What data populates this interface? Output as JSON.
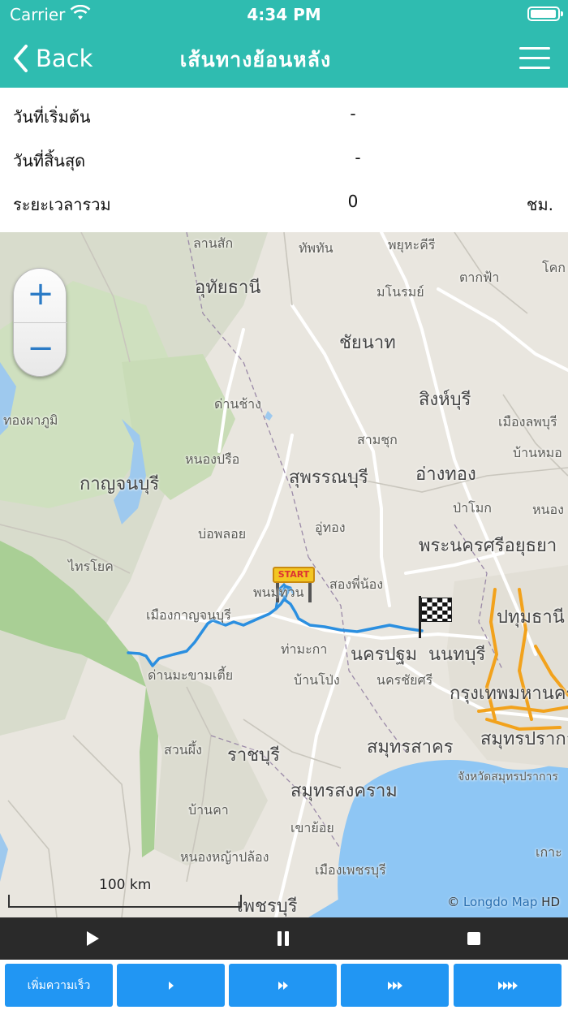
{
  "status_bar": {
    "carrier": "Carrier",
    "time": "4:34 PM"
  },
  "nav": {
    "back_label": "Back",
    "title": "เส้นทางย้อนหลัง"
  },
  "info": {
    "start_date_label": "วันที่เริ่มต้น",
    "start_date_value": "-",
    "end_date_label": "วันที่สิ้นสุด",
    "end_date_value": "-",
    "total_duration_label": "ระยะเวลารวม",
    "total_duration_value": "0",
    "total_duration_unit": "ชม."
  },
  "map": {
    "places": [
      "ลานสัก",
      "ทัพทัน",
      "พยุหะคีรี",
      "อุทัยธานี",
      "มโนรมย์",
      "ตากฟ้า",
      "โคก",
      "ชัยนาท",
      "สิงห์บุรี",
      "ด่านช้าง",
      "ทองผาภูมิ",
      "เมืองลพบุรี",
      "สามชุก",
      "หนองปรือ",
      "กาญจนบุรี",
      "สุพรรณบุรี",
      "อ่างทอง",
      "บ้านหมอ",
      "ป่าโมก",
      "บ่อพลอย",
      "อู่ทอง",
      "หนอง",
      "พระนครศรีอยุธยา",
      "ไทรโยค",
      "สองพี่น้อง",
      "พนมทวน",
      "ปทุมธานี",
      "เมืองกาญจนบุรี",
      "ท่ามะกา",
      "นครปฐม",
      "นนทบุรี",
      "ด่านมะขามเตี้ย",
      "บ้านโป่ง",
      "นครชัยศรี",
      "กรุงเทพมหานคร",
      "สวนผึ้ง",
      "ราชบุรี",
      "สมุทรสาคร",
      "สมุทรปราการ",
      "จังหวัดสมุทรปราการ",
      "สมุทรสงคราม",
      "บ้านคา",
      "เขาย้อย",
      "หนองหญ้าปล้อง",
      "เมืองเพชรบุรี",
      "เพชรบุรี",
      "เกาะ"
    ],
    "start_marker_label": "START",
    "scale_label": "100 km",
    "credit_prefix": "© ",
    "credit_brand": "Longdo Map",
    "credit_suffix": " HD",
    "zoom_in": "+",
    "zoom_out": "−"
  },
  "speeds": {
    "speed_up_label": "เพิ่มความเร็ว"
  },
  "colors": {
    "header": "#2fbcb0",
    "speed_button": "#2196f3",
    "route": "#2b8fe0",
    "playbar": "#2a2a2a"
  }
}
